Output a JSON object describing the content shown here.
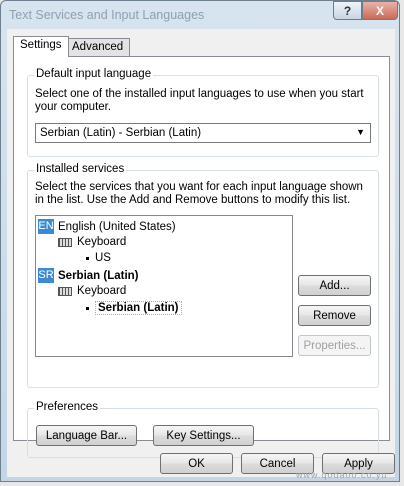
{
  "window": {
    "title": "Text Services and Input Languages",
    "help_glyph": "?",
    "close_glyph": "X"
  },
  "tabs": [
    {
      "label": "Settings",
      "active": true
    },
    {
      "label": "Advanced",
      "active": false
    }
  ],
  "default_language": {
    "title": "Default input language",
    "description": "Select one of the installed input languages to use when you start your computer.",
    "selected": "Serbian (Latin) - Serbian (Latin)",
    "arrow": "▼"
  },
  "installed_services": {
    "title": "Installed services",
    "description": "Select the services that you want for each input language shown in the list. Use the Add and Remove buttons to modify this list.",
    "tree": [
      {
        "badge": "EN",
        "language": "English (United States)",
        "category": "Keyboard",
        "layout": "US"
      },
      {
        "badge": "SR",
        "language": "Serbian (Latin)",
        "category": "Keyboard",
        "layout": "Serbian (Latin)"
      }
    ],
    "buttons": {
      "add": "Add...",
      "remove": "Remove",
      "properties": "Properties..."
    }
  },
  "preferences": {
    "title": "Preferences",
    "language_bar": "Language Bar...",
    "key_settings": "Key Settings..."
  },
  "footer": {
    "ok": "OK",
    "cancel": "Cancel",
    "apply": "Apply"
  },
  "watermark": "www.qodaoo.co.yu"
}
